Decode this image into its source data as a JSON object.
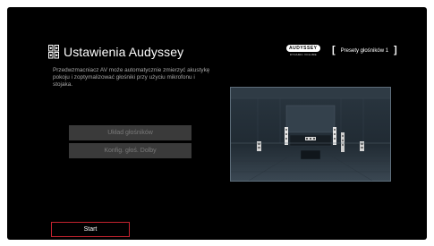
{
  "header": {
    "title": "Ustawienia Audyssey",
    "title_icon": "setup-icon"
  },
  "brand": {
    "logo_text": "AUDYSSEY",
    "subtext": "DYNAMIC VOLUME"
  },
  "preset": {
    "label": "Presety głośników 1",
    "bracket_open": "[",
    "bracket_close": "]"
  },
  "description": "Przedwzmacniacz AV może automatycznie zmierzyć akustykę pokoju i zoptymalizować głośniki przy użyciu mikrofonu i stojaka.",
  "menu": {
    "items": [
      {
        "label": "Układ głośników"
      },
      {
        "label": "Konfig. głoś. Dolby"
      }
    ]
  },
  "room_image": {
    "description_icon": "room-speaker-setup-icon"
  },
  "start_button": {
    "label": "Start"
  },
  "colors": {
    "background": "#000000",
    "accent": "#c4232f",
    "menu_button": "#3a3a3a",
    "menu_text": "#7a7a7a",
    "description_text": "#a7a7a7"
  }
}
